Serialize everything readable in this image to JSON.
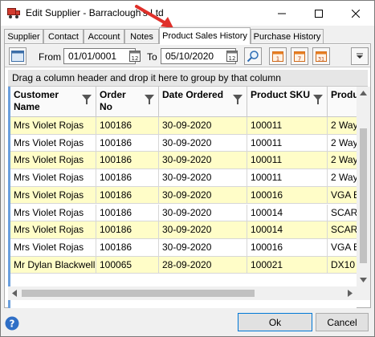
{
  "window": {
    "title": "Edit Supplier - Barraclough's Ltd",
    "minimize_glyph": "—",
    "maximize_glyph": "☐",
    "close_glyph": "✕"
  },
  "tabs": [
    {
      "label": "Supplier",
      "active": false
    },
    {
      "label": "Contact",
      "active": false
    },
    {
      "label": "Account",
      "active": false
    },
    {
      "label": "Notes",
      "active": false
    },
    {
      "label": "Product Sales History",
      "active": true
    },
    {
      "label": "Purchase History",
      "active": false
    }
  ],
  "toolbar": {
    "from_label": "From",
    "from_value": "01/01/0001",
    "to_label": "To",
    "to_value": "05/10/2020",
    "quick_buttons": [
      "1",
      "7",
      "31"
    ]
  },
  "group_panel": {
    "text": "Drag a column header and drop it here to group by that column"
  },
  "grid": {
    "columns": [
      {
        "label": "Customer Name"
      },
      {
        "label": "Order No"
      },
      {
        "label": "Date Ordered"
      },
      {
        "label": "Product SKU"
      },
      {
        "label": "Product"
      }
    ],
    "rows": [
      [
        "Mrs Violet Rojas",
        "100186",
        "30-09-2020",
        "100011",
        "2 Way"
      ],
      [
        "Mrs Violet Rojas",
        "100186",
        "30-09-2020",
        "100011",
        "2 Way"
      ],
      [
        "Mrs Violet Rojas",
        "100186",
        "30-09-2020",
        "100011",
        "2 Way"
      ],
      [
        "Mrs Violet Rojas",
        "100186",
        "30-09-2020",
        "100011",
        "2 Way"
      ],
      [
        "Mrs Violet Rojas",
        "100186",
        "30-09-2020",
        "100016",
        "VGA E"
      ],
      [
        "Mrs Violet Rojas",
        "100186",
        "30-09-2020",
        "100014",
        "SCAR"
      ],
      [
        "Mrs Violet Rojas",
        "100186",
        "30-09-2020",
        "100014",
        "SCAR"
      ],
      [
        "Mrs Violet Rojas",
        "100186",
        "30-09-2020",
        "100016",
        "VGA E"
      ],
      [
        "Mr Dylan Blackwell",
        "100065",
        "28-09-2020",
        "100021",
        "DX10"
      ]
    ]
  },
  "footer": {
    "ok_label": "Ok",
    "cancel_label": "Cancel",
    "help_glyph": "?"
  },
  "colors": {
    "row_highlight": "#fffdc8",
    "accent_blue": "#6b9fdd",
    "annotation_arrow": "#e0302a"
  }
}
